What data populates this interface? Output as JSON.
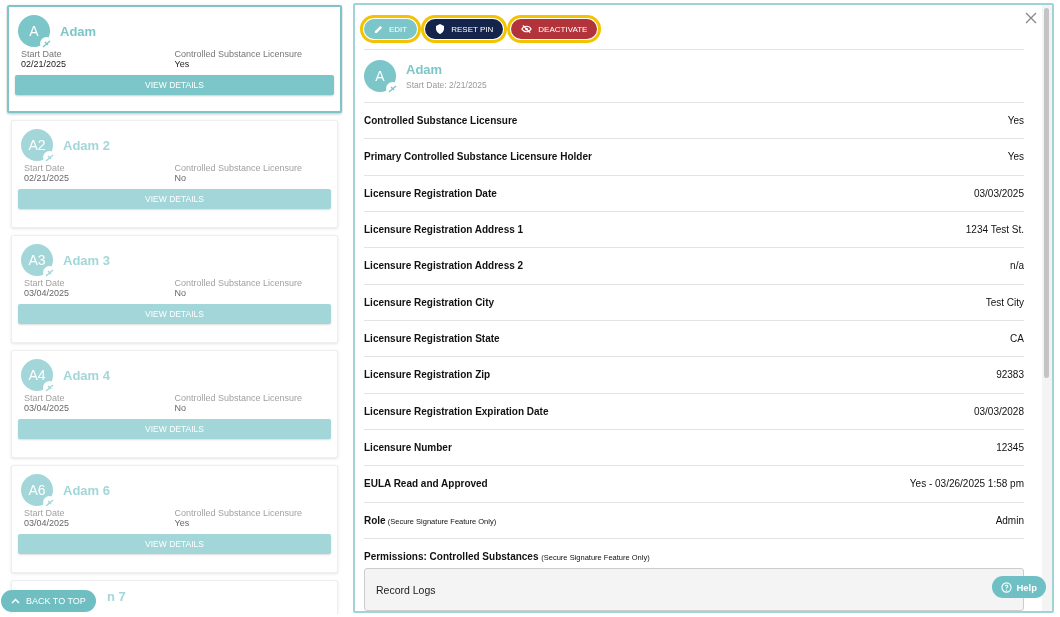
{
  "cards": [
    {
      "initials": "A",
      "name": "Adam",
      "start_label": "Start Date",
      "start_date": "02/21/2025",
      "license_label": "Controlled Substance Licensure",
      "license": "Yes",
      "button": "VIEW DETAILS",
      "selected": true
    },
    {
      "initials": "A2",
      "name": "Adam 2",
      "start_label": "Start Date",
      "start_date": "02/21/2025",
      "license_label": "Controlled Substance Licensure",
      "license": "No",
      "button": "VIEW DETAILS",
      "selected": false
    },
    {
      "initials": "A3",
      "name": "Adam 3",
      "start_label": "Start Date",
      "start_date": "03/04/2025",
      "license_label": "Controlled Substance Licensure",
      "license": "No",
      "button": "VIEW DETAILS",
      "selected": false
    },
    {
      "initials": "A4",
      "name": "Adam 4",
      "start_label": "Start Date",
      "start_date": "03/04/2025",
      "license_label": "Controlled Substance Licensure",
      "license": "No",
      "button": "VIEW DETAILS",
      "selected": false
    },
    {
      "initials": "A6",
      "name": "Adam 6",
      "start_label": "Start Date",
      "start_date": "03/04/2025",
      "license_label": "Controlled Substance Licensure",
      "license": "Yes",
      "button": "VIEW DETAILS",
      "selected": false
    },
    {
      "name": "n 7",
      "selected": false
    }
  ],
  "back_to_top": "BACK TO TOP",
  "detail": {
    "actions": [
      {
        "kind": "edit",
        "label": "EDIT",
        "highlighted": true
      },
      {
        "kind": "reset",
        "label": "RESET PIN",
        "highlighted": true
      },
      {
        "kind": "deactivate",
        "label": "DEACTIVATE",
        "highlighted": true
      }
    ],
    "initials": "A",
    "name": "Adam",
    "start": "Start Date: 2/21/2025",
    "rows": [
      {
        "label": "Controlled Substance Licensure",
        "value": "Yes"
      },
      {
        "label": "Primary Controlled Substance Licensure Holder",
        "value": "Yes"
      },
      {
        "label": "Licensure Registration Date",
        "value": "03/03/2025"
      },
      {
        "label": "Licensure Registration Address 1",
        "value": "1234 Test St."
      },
      {
        "label": "Licensure Registration Address 2",
        "value": "n/a"
      },
      {
        "label": "Licensure Registration City",
        "value": "Test City"
      },
      {
        "label": "Licensure Registration State",
        "value": "CA"
      },
      {
        "label": "Licensure Registration Zip",
        "value": "92383"
      },
      {
        "label": "Licensure Registration Expiration Date",
        "value": "03/03/2028"
      },
      {
        "label": "Licensure Number",
        "value": "12345"
      },
      {
        "label": "EULA Read and Approved",
        "value": "Yes - 03/26/2025 1:58 pm"
      },
      {
        "label": "Role",
        "note": "(Secure Signature Feature Only)",
        "value": "Admin"
      }
    ],
    "permissions": {
      "label": "Permissions: Controlled Substances",
      "note": "(Secure Signature Feature Only)",
      "items": [
        "Record Logs"
      ]
    }
  },
  "help": "Help"
}
